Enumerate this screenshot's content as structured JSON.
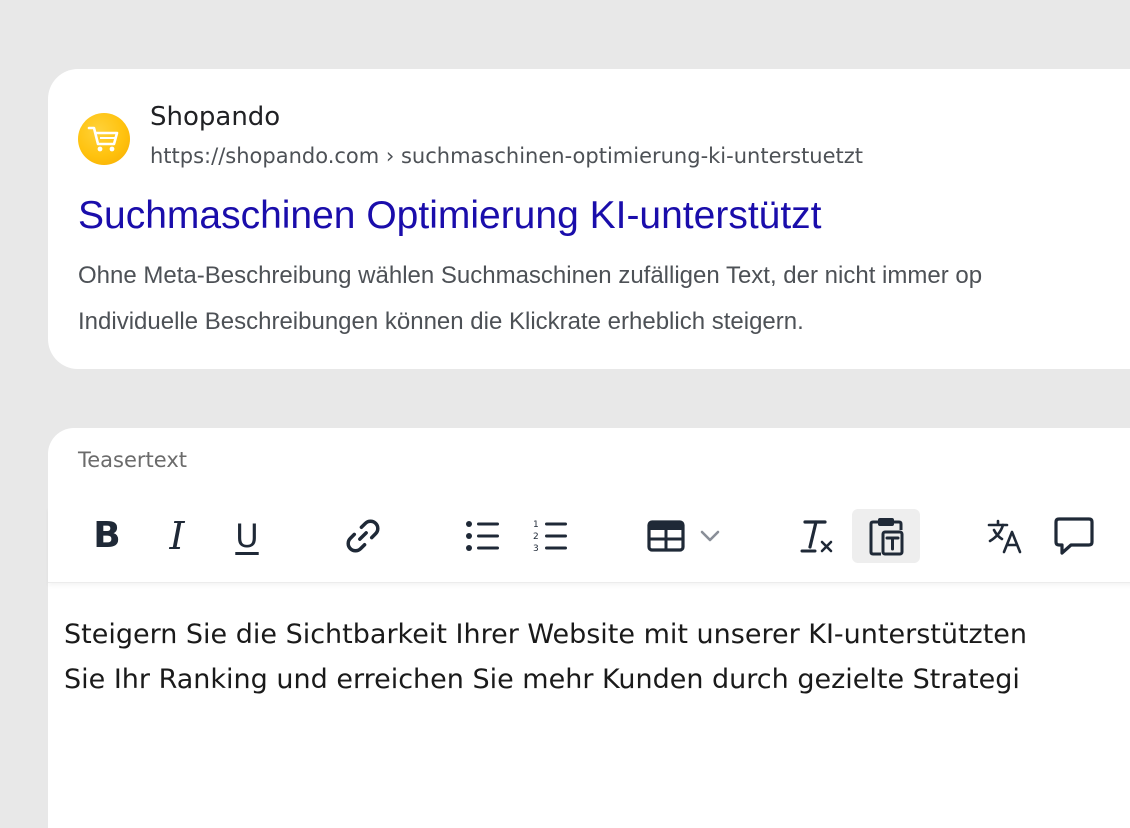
{
  "serp_preview": {
    "site_name": "Shopando",
    "site_url": "https://shopando.com › suchmaschinen-optimierung-ki-unterstuetzt",
    "title": "Suchmaschinen Optimierung KI-unterstützt",
    "description_lines": [
      "Ohne Meta-Beschreibung wählen Suchmaschinen zufälligen Text, der nicht immer op",
      "Individuelle Beschreibungen können die Klickrate erheblich steigern."
    ],
    "logo_icon": "shopping-cart-icon",
    "logo_color": "#ffc20e",
    "title_color": "#1a0dab"
  },
  "editor": {
    "label": "Teasertext",
    "toolbar": {
      "bold_label": "B",
      "italic_label": "I",
      "underline_label": "U",
      "icons": [
        "bold-icon",
        "italic-icon",
        "underline-icon",
        "link-icon",
        "bullet-list-icon",
        "numbered-list-icon",
        "table-icon",
        "chevron-down-icon",
        "clear-formatting-icon",
        "paste-as-text-icon",
        "translate-icon",
        "comment-icon"
      ],
      "active_button": "paste-as-text"
    },
    "content_lines": [
      "Steigern Sie die Sichtbarkeit Ihrer Website mit unserer KI-unterstützten",
      "Sie Ihr Ranking und erreichen Sie mehr Kunden durch gezielte Strategi"
    ]
  },
  "colors": {
    "background": "#e8e8e8",
    "card": "#ffffff",
    "active_button_bg": "#eeeeee"
  }
}
